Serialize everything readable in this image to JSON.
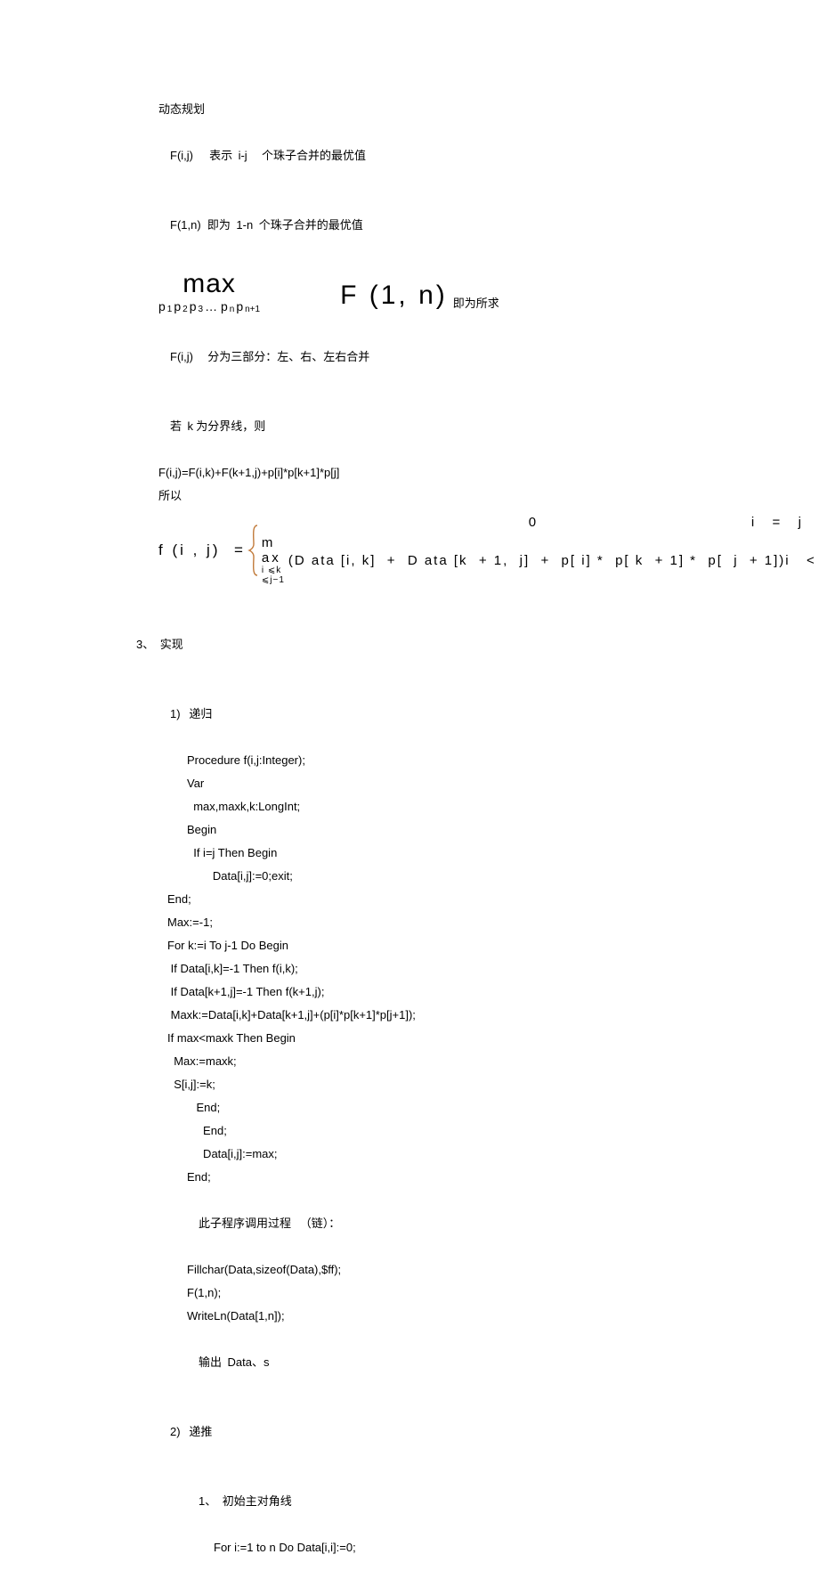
{
  "intro": {
    "l1": "动态规划",
    "l2_a": "F(i,j)",
    "l2_b": "表示",
    "l2_c": "i-j",
    "l2_d": "个珠子合并的最优值",
    "l3_a": "F(1,n)",
    "l3_b": "即为",
    "l3_c": "1-n",
    "l3_d": "个珠子合并的最优值"
  },
  "formula1": {
    "max": "max",
    "subs_parts": [
      "p",
      "1",
      " p",
      "2",
      " p",
      "3",
      " … p",
      "n",
      " p",
      "n+1"
    ],
    "func": "F (1, n)",
    "tail": "即为所求"
  },
  "mid": {
    "l1_a": "F(i,j)",
    "l1_b": "分为三部分：左、右、左右合并",
    "l2_a": "若",
    "l2_b": "k",
    "l2_c": "为分界线，则",
    "l3": "F(i,j)=F(i,k)+F(k+1,j)+p[i]*p[k+1]*p[j]",
    "l4": "所以"
  },
  "formula2": {
    "lhs": "f (i , j)  =",
    "row1_mid": "0",
    "row1_cond": "i  =  j",
    "row2_max": "m ax",
    "row2_sub": "i ⩽k ⩽j−1",
    "row2_expr": "(D ata [i, k]  +  D ata [k  + 1,  j]  +  p[ i] *  p[ k  + 1] *  p[  j  + 1])",
    "row2_cond": "i  <  j"
  },
  "sec": {
    "num": "3、",
    "title": "实现",
    "item1_num": "1)",
    "item1_title": "递归",
    "code": {
      "c01": "Procedure f(i,j:Integer);",
      "c02": "Var",
      "c03": "  max,maxk,k:LongInt;",
      "c04": "Begin",
      "c05": "  If i=j Then Begin",
      "c06": "        Data[i,j]:=0;exit;",
      "c07": "End;",
      "c08": "Max:=-1;",
      "c09": "For k:=i To j-1 Do Begin",
      "c10": " If Data[i,k]=-1 Then f(i,k);",
      "c11": " If Data[k+1,j]=-1 Then f(k+1,j);",
      "c12": " Maxk:=Data[i,k]+Data[k+1,j]+(p[i]*p[k+1]*p[j+1]);",
      "c13": "If max<maxk Then Begin",
      "c14": "  Max:=maxk;",
      "c15": "  S[i,j]:=k;",
      "c16": "         End;",
      "c17": "     End;",
      "c18": "     Data[i,j]:=max;",
      "c19": "End;",
      "c20_a": "此子程序调用过程",
      "c20_b": "（链）：",
      "c21": "Fillchar(Data,sizeof(Data),$ff);",
      "c22": "F(1,n);",
      "c23": "WriteLn(Data[1,n]);",
      "c24_a": "输出",
      "c24_b": "Data、s"
    },
    "item2_num": "2)",
    "item2_title": "递推",
    "sub1_num": "1、",
    "sub1_title": "初始主对角线",
    "sub1_code": "For i:=1 to n Do Data[i,i]:=0;"
  }
}
